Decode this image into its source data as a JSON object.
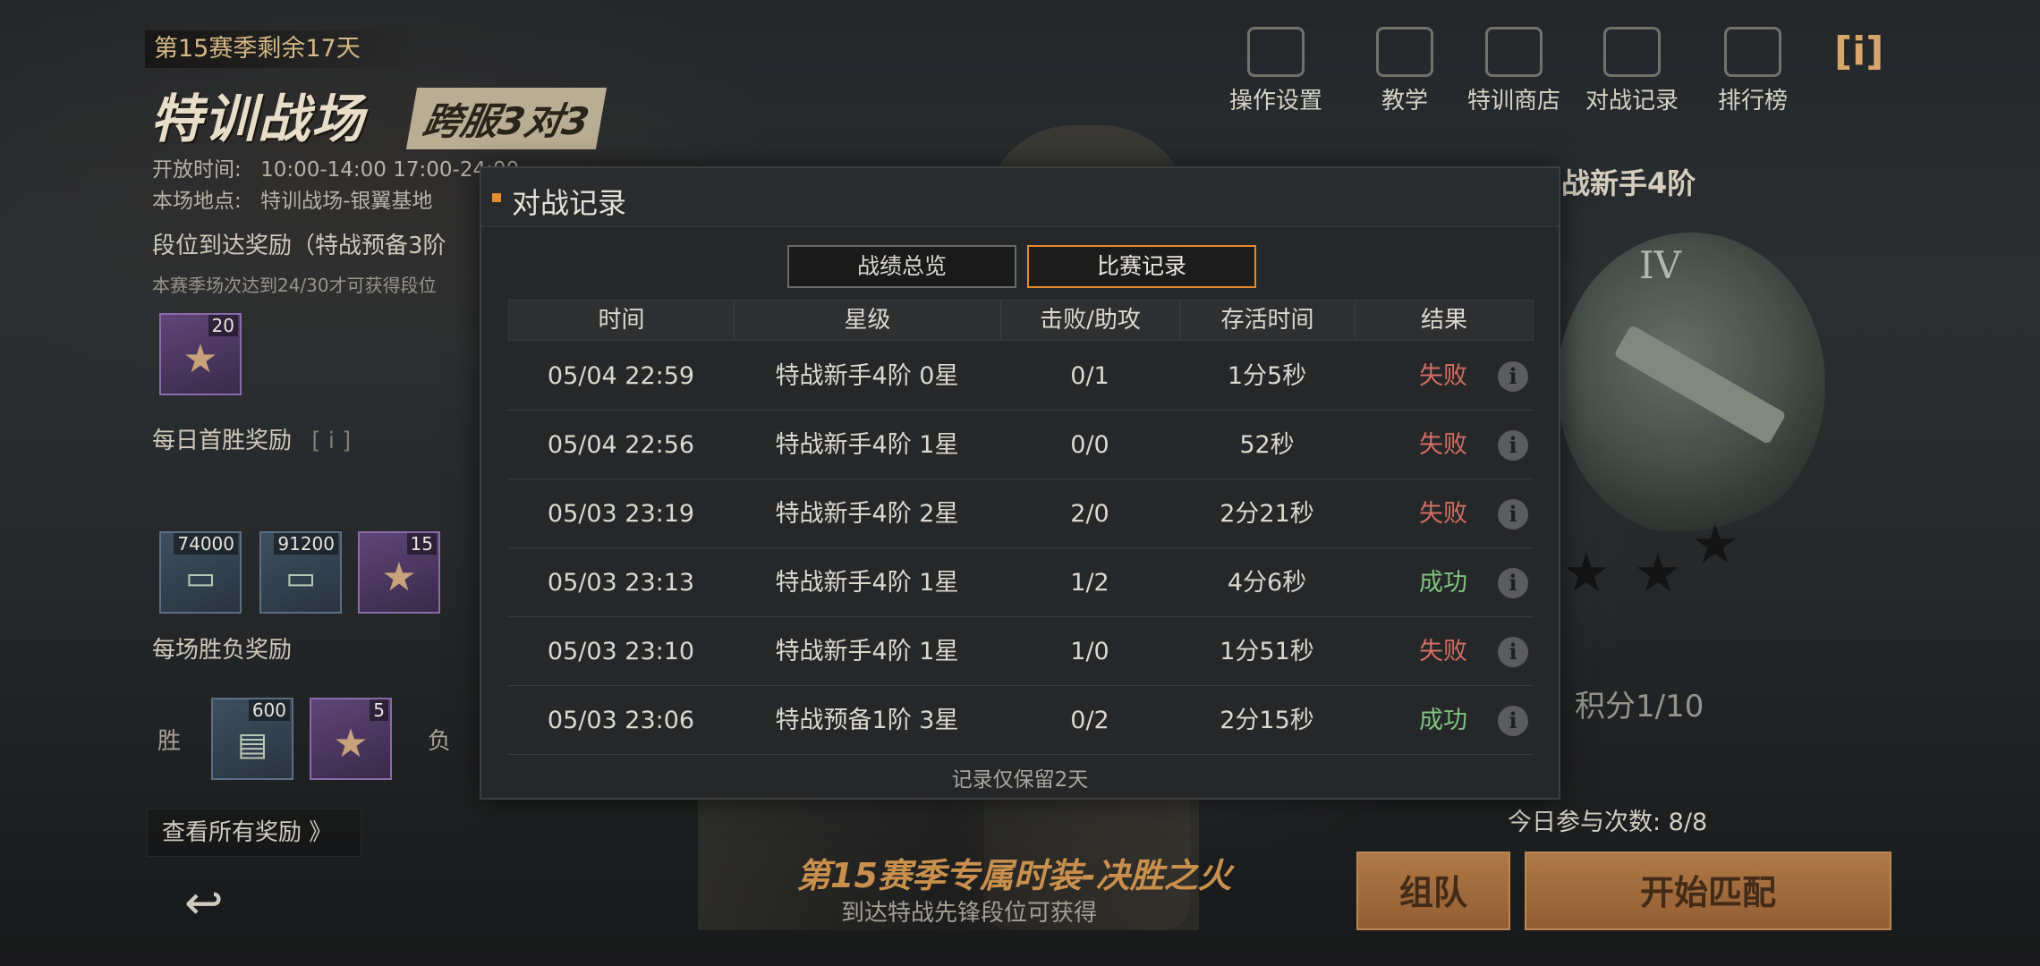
{
  "season": {
    "remaining": "第15赛季剩余17天"
  },
  "mode": {
    "title": "特训战场",
    "badge": "跨服3对3"
  },
  "info": {
    "open_time_label": "开放时间:",
    "open_time_value": "10:00-14:00 17:00-24:00",
    "location_label": "本场地点:",
    "location_value": "特训战场-银翼基地"
  },
  "rewards": {
    "rank_reward_title": "段位到达奖励（特战预备3阶",
    "rank_reward_note": "本赛季场次达到24/30才可获得段位",
    "rank_item_qty": "20",
    "daily_first_win": "每日首胜奖励",
    "daily_items": [
      "74000",
      "91200",
      "15"
    ],
    "per_match": "每场胜负奖励",
    "win_label": "胜",
    "lose_label": "负",
    "win_items": [
      "600",
      "5"
    ],
    "view_all": "查看所有奖励 》"
  },
  "nav": [
    {
      "label": "操作设置",
      "icon": "gear-settings-icon"
    },
    {
      "label": "教学",
      "icon": "tutorial-board-icon"
    },
    {
      "label": "特训商店",
      "icon": "shop-icon"
    },
    {
      "label": "对战记录",
      "icon": "battle-record-icon"
    },
    {
      "label": "排行榜",
      "icon": "trophy-icon"
    }
  ],
  "info_icon": "[i]",
  "rank": {
    "title": "战新手4阶",
    "roman": "IV",
    "points": "积分1/10",
    "today": "今日参与次数: 8/8"
  },
  "promo": {
    "title": "第15赛季专属时装-决胜之火",
    "sub": "到达特战先锋段位可获得"
  },
  "buttons": {
    "team": "组队",
    "match": "开始匹配"
  },
  "dialog": {
    "title": "对战记录",
    "tabs": [
      "战绩总览",
      "比赛记录"
    ],
    "active_tab": "比赛记录",
    "columns": [
      "时间",
      "星级",
      "击败/助攻",
      "存活时间",
      "结果"
    ],
    "rows": [
      {
        "time": "05/04 22:59",
        "rank": "特战新手4阶 0星",
        "ka": "0/1",
        "survive": "1分5秒",
        "result": "失败",
        "win": false
      },
      {
        "time": "05/04 22:56",
        "rank": "特战新手4阶 1星",
        "ka": "0/0",
        "survive": "52秒",
        "result": "失败",
        "win": false
      },
      {
        "time": "05/03 23:19",
        "rank": "特战新手4阶 2星",
        "ka": "2/0",
        "survive": "2分21秒",
        "result": "失败",
        "win": false
      },
      {
        "time": "05/03 23:13",
        "rank": "特战新手4阶 1星",
        "ka": "1/2",
        "survive": "4分6秒",
        "result": "成功",
        "win": true
      },
      {
        "time": "05/03 23:10",
        "rank": "特战新手4阶 1星",
        "ka": "1/0",
        "survive": "1分51秒",
        "result": "失败",
        "win": false
      },
      {
        "time": "05/03 23:06",
        "rank": "特战预备1阶 3星",
        "ka": "0/2",
        "survive": "2分15秒",
        "result": "成功",
        "win": true
      }
    ],
    "footnote": "记录仅保留2天"
  },
  "colors": {
    "accent": "#e08a2e",
    "win": "#7ec27e",
    "lose": "#d46e64"
  }
}
